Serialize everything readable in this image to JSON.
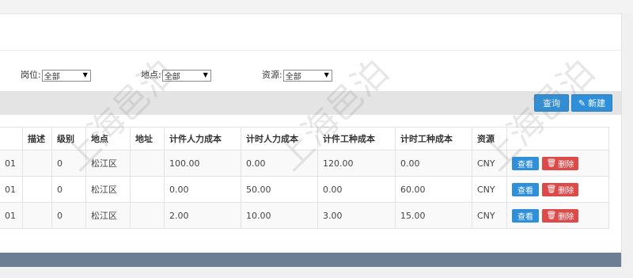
{
  "filters": {
    "position": {
      "label": "岗位:",
      "value": "全部"
    },
    "location": {
      "label": "地点:",
      "value": "全部"
    },
    "source": {
      "label": "资源:",
      "value": "全部"
    }
  },
  "toolbar": {
    "query_label": "查询",
    "new_label": "新建"
  },
  "table": {
    "headers": [
      "",
      "描述",
      "级别",
      "地点",
      "地址",
      "计件人力成本",
      "计时人力成本",
      "计件工种成本",
      "计时工种成本",
      "资源",
      ""
    ],
    "rows": [
      {
        "code": "01",
        "desc": "",
        "level": "0",
        "location": "松江区",
        "address": "",
        "piece_labor": "100.00",
        "time_labor": "0.00",
        "piece_type": "120.00",
        "time_type": "0.00",
        "source": "CNY"
      },
      {
        "code": "01",
        "desc": "",
        "level": "0",
        "location": "松江区",
        "address": "",
        "piece_labor": "0.00",
        "time_labor": "50.00",
        "piece_type": "0.00",
        "time_type": "60.00",
        "source": "CNY"
      },
      {
        "code": "01",
        "desc": "",
        "level": "0",
        "location": "松江区",
        "address": "",
        "piece_labor": "2.00",
        "time_labor": "10.00",
        "piece_type": "3.00",
        "time_type": "15.00",
        "source": "CNY"
      }
    ],
    "view_label": "查看",
    "delete_label": "删除"
  },
  "watermark": "上海邑泊"
}
